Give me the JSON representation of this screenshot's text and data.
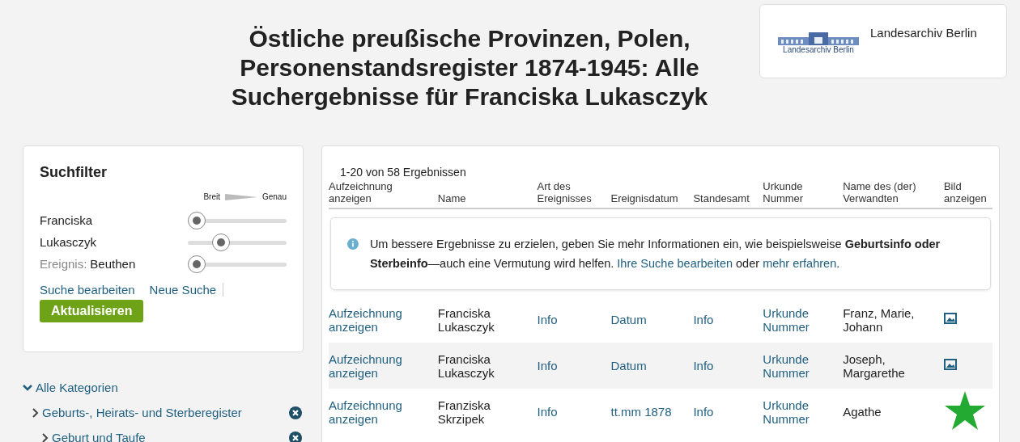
{
  "title": [
    "Östliche preußische Provinzen, Polen,",
    "Personenstandsregister 1874-1945: Alle",
    "Suchergebnisse für Franciska Lukasczyk"
  ],
  "archive": {
    "logo_text": "Landesarchiv Berlin",
    "name": "Landesarchiv Berlin"
  },
  "filter": {
    "title": "Suchfilter",
    "scale": {
      "low": "Breit",
      "high": "Genau"
    },
    "terms": [
      {
        "label": "Franciska",
        "level": 0
      },
      {
        "label": "Lukasczyk",
        "level": 0.3
      },
      {
        "prefix": "Ereignis:",
        "label": "Beuthen",
        "level": 0
      }
    ],
    "links": [
      "Suche bearbeiten",
      "Neue Suche"
    ],
    "button": "Aktualisieren"
  },
  "categories": [
    {
      "label": "Alle Kategorien",
      "expanded": true,
      "removable": false,
      "children": [
        {
          "label": "Geburts-, Heirats- und Sterberegister",
          "expanded": false,
          "removable": true,
          "children": [
            {
              "label": "Geburt und Taufe",
              "expanded": false,
              "removable": true
            }
          ]
        }
      ]
    }
  ],
  "results": {
    "count": "1-20 von 58 Ergebnissen",
    "columns": [
      "Aufzeichnung anzeigen",
      "Name",
      "Art des Ereignisses",
      "Ereignisdatum",
      "Standesamt",
      "Urkunde Nummer",
      "Name des (der) Verwandten",
      "Bild anzeigen"
    ],
    "notice": [
      {
        "kind": "text",
        "text": "Um bessere Ergebnisse zu erzielen, geben Sie mehr Informationen ein, wie beispielsweise "
      },
      {
        "kind": "bold",
        "text": "Geburtsinfo oder Sterbeinfo"
      },
      {
        "kind": "text",
        "text": "—auch eine Vermutung wird helfen. "
      },
      {
        "kind": "link",
        "text": "Ihre Suche bearbeiten"
      },
      {
        "kind": "text",
        "text": " oder "
      },
      {
        "kind": "link",
        "text": "mehr erfahren"
      },
      {
        "kind": "text",
        "text": "."
      }
    ],
    "rows": [
      {
        "record": "Aufzeichnung anzeigen",
        "name": "Franciska Lukasczyk",
        "event": "Info",
        "date": "Datum",
        "office": "Info",
        "number": "Urkunde Nummer",
        "relatives": "Franz, Marie, Johann",
        "kind": "image"
      },
      {
        "record": "Aufzeichnung anzeigen",
        "name": "Franciska Lukasczyk",
        "event": "Info",
        "date": "Datum",
        "office": "Info",
        "number": "Urkunde Nummer",
        "relatives": "Joseph, Margarethe",
        "kind": "image"
      },
      {
        "record": "Aufzeichnung anzeigen",
        "name": "Franziska Skrzipek",
        "event": "Info",
        "date": "tt.mm 1878",
        "office": "Info",
        "number": "Urkunde Nummer",
        "relatives": "Agathe",
        "kind": "star"
      }
    ]
  }
}
